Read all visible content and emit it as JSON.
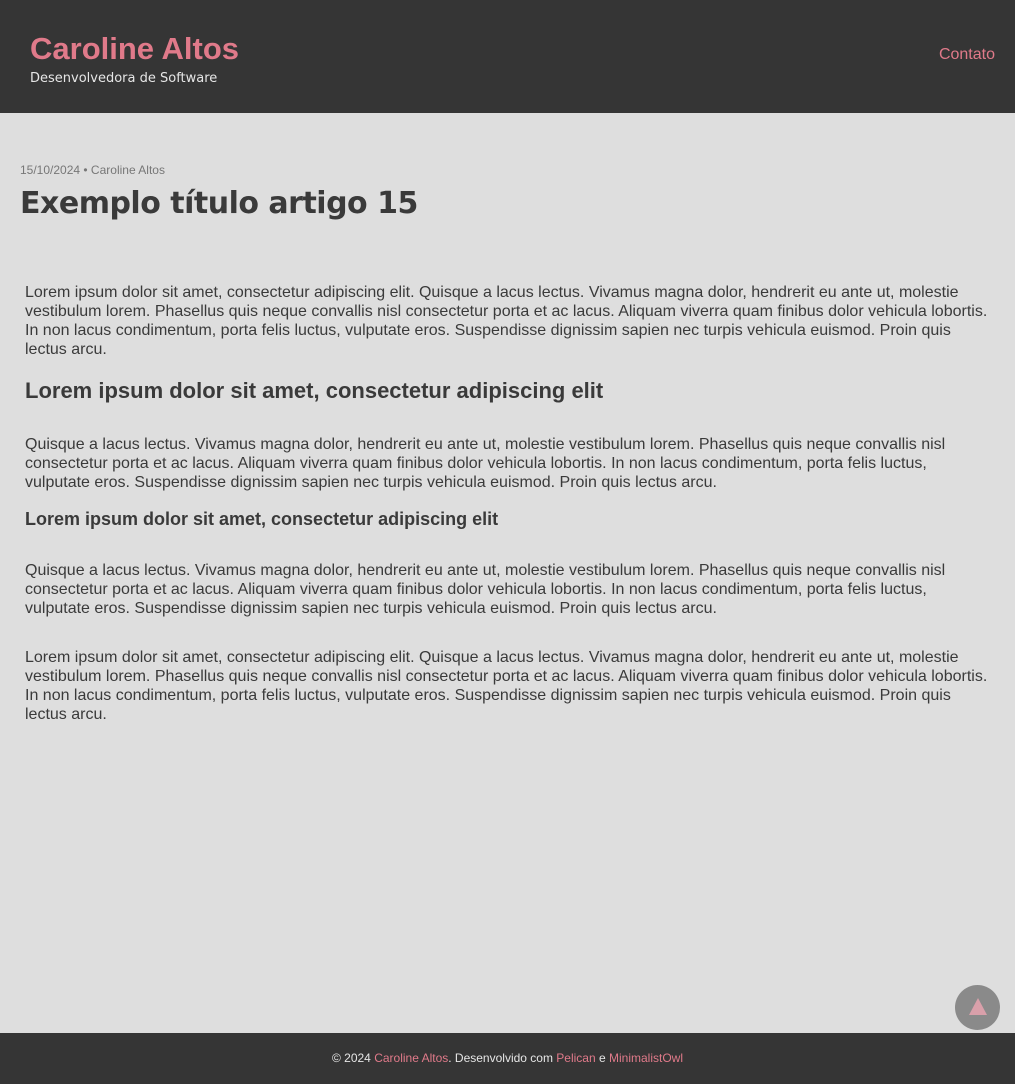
{
  "header": {
    "site_title": "Caroline Altos",
    "site_subtitle": "Desenvolvedora de Software",
    "nav": [
      {
        "label": "Contato"
      }
    ]
  },
  "post": {
    "meta": "15/10/2024 • Caroline Altos",
    "title": "Exemplo título artigo 15",
    "paragraph_1": "Lorem ipsum dolor sit amet, consectetur adipiscing elit. Quisque a lacus lectus. Vivamus magna dolor, hendrerit eu ante ut, molestie vestibulum lorem. Phasellus quis neque convallis nisl consectetur porta et ac lacus. Aliquam viverra quam finibus dolor vehicula lobortis. In non lacus condimentum, porta felis luctus, vulputate eros. Suspendisse dignissim sapien nec turpis vehicula euismod. Proin quis lectus arcu.",
    "heading_2": "Lorem ipsum dolor sit amet, consectetur adipiscing elit",
    "paragraph_2": "Quisque a lacus lectus. Vivamus magna dolor, hendrerit eu ante ut, molestie vestibulum lorem. Phasellus quis neque convallis nisl consectetur porta et ac lacus. Aliquam viverra quam finibus dolor vehicula lobortis. In non lacus condimentum, porta felis luctus, vulputate eros. Suspendisse dignissim sapien nec turpis vehicula euismod. Proin quis lectus arcu.",
    "heading_3": "Lorem ipsum dolor sit amet, consectetur adipiscing elit",
    "paragraph_3": "Quisque a lacus lectus. Vivamus magna dolor, hendrerit eu ante ut, molestie vestibulum lorem. Phasellus quis neque convallis nisl consectetur porta et ac lacus. Aliquam viverra quam finibus dolor vehicula lobortis. In non lacus condimentum, porta felis luctus, vulputate eros. Suspendisse dignissim sapien nec turpis vehicula euismod. Proin quis lectus arcu.",
    "paragraph_4": "Lorem ipsum dolor sit amet, consectetur adipiscing elit. Quisque a lacus lectus. Vivamus magna dolor, hendrerit eu ante ut, molestie vestibulum lorem. Phasellus quis neque convallis nisl consectetur porta et ac lacus. Aliquam viverra quam finibus dolor vehicula lobortis. In non lacus condimentum, porta felis luctus, vulputate eros. Suspendisse dignissim sapien nec turpis vehicula euismod. Proin quis lectus arcu."
  },
  "back_to_top": {
    "icon": "triangle-up-icon"
  },
  "footer": {
    "prefix": "© 2024 ",
    "author": "Caroline Altos",
    "middle": ". Desenvolvido com ",
    "pelican": "Pelican",
    "connector": " e ",
    "theme": "MinimalistOwl"
  },
  "colors": {
    "header_bg": "#353535",
    "page_bg": "#dedede",
    "accent": "#e07a8a",
    "text": "#3a3a3a"
  }
}
